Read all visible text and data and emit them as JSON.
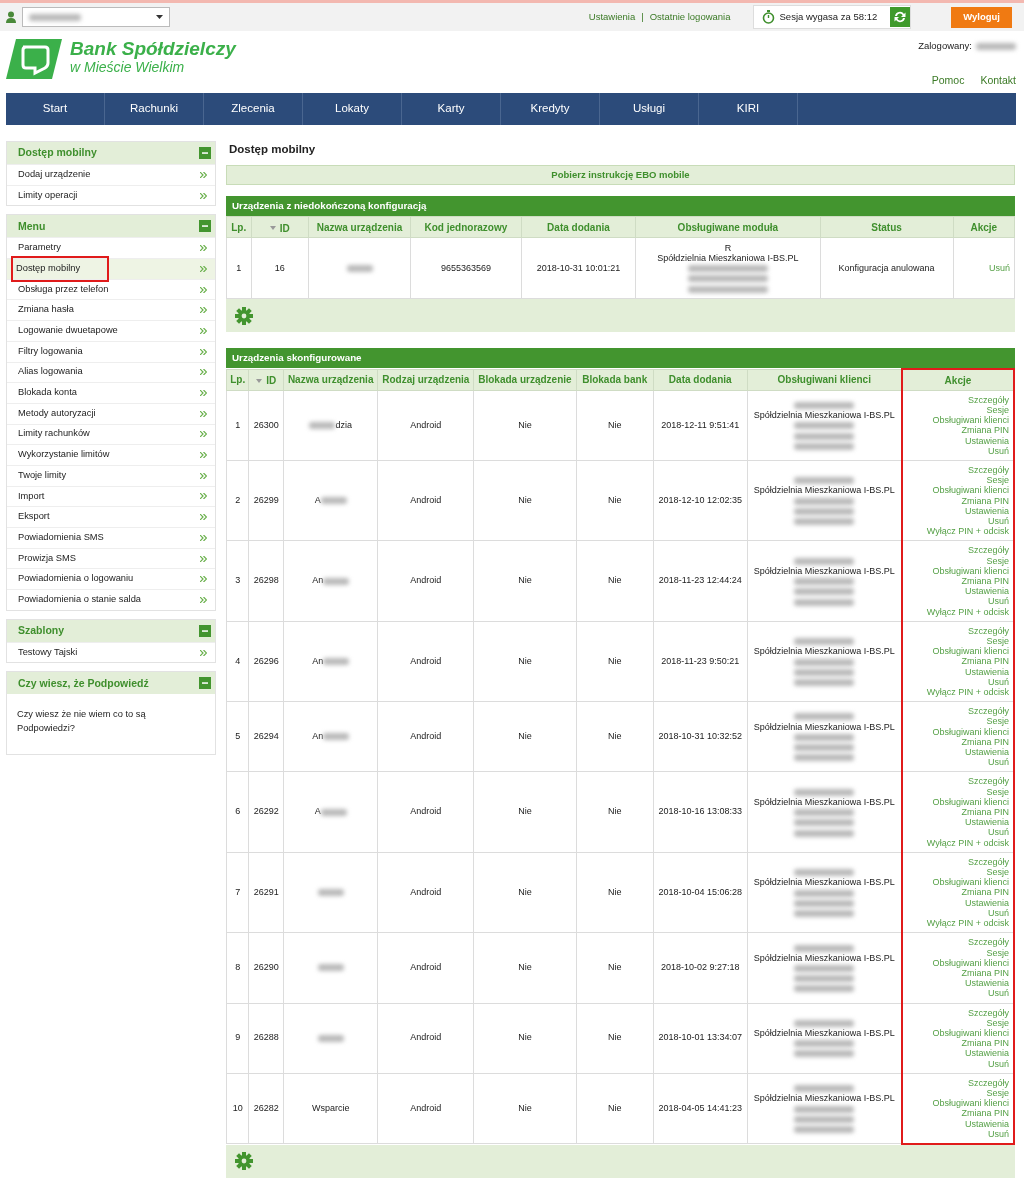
{
  "topbar": {
    "links": [
      {
        "label": "Ustawienia"
      },
      {
        "label": "Ostatnie logowania"
      }
    ],
    "separator": "|",
    "session": "Sesja wygasa za 58:12",
    "logout": "Wyloguj"
  },
  "logo": {
    "line1": "Bank Spółdzielczy",
    "line2": "w Mieście Wielkim"
  },
  "logged_in": {
    "label": "Zalogowany:"
  },
  "header_links": [
    {
      "label": "Pomoc"
    },
    {
      "label": "Kontakt"
    }
  ],
  "nav": [
    {
      "label": "Start"
    },
    {
      "label": "Rachunki"
    },
    {
      "label": "Zlecenia"
    },
    {
      "label": "Lokaty"
    },
    {
      "label": "Karty"
    },
    {
      "label": "Kredyty"
    },
    {
      "label": "Usługi"
    },
    {
      "label": "KIRI"
    }
  ],
  "sidebar": [
    {
      "title": "Dostęp mobilny",
      "kind": "links",
      "items": [
        {
          "label": "Dodaj urządzenie",
          "selected": false,
          "highlighted": false
        },
        {
          "label": "Limity operacji",
          "selected": false,
          "highlighted": false
        }
      ]
    },
    {
      "title": "Menu",
      "kind": "links",
      "items": [
        {
          "label": "Parametry",
          "selected": false,
          "highlighted": false
        },
        {
          "label": "Dostęp mobilny",
          "selected": true,
          "highlighted": true
        },
        {
          "label": "Obsługa przez telefon",
          "selected": false,
          "highlighted": false
        },
        {
          "label": "Zmiana hasła",
          "selected": false,
          "highlighted": false
        },
        {
          "label": "Logowanie dwuetapowe",
          "selected": false,
          "highlighted": false
        },
        {
          "label": "Filtry logowania",
          "selected": false,
          "highlighted": false
        },
        {
          "label": "Alias logowania",
          "selected": false,
          "highlighted": false
        },
        {
          "label": "Blokada konta",
          "selected": false,
          "highlighted": false
        },
        {
          "label": "Metody autoryzacji",
          "selected": false,
          "highlighted": false
        },
        {
          "label": "Limity rachunków",
          "selected": false,
          "highlighted": false
        },
        {
          "label": "Wykorzystanie limitów",
          "selected": false,
          "highlighted": false
        },
        {
          "label": "Twoje limity",
          "selected": false,
          "highlighted": false
        },
        {
          "label": "Import",
          "selected": false,
          "highlighted": false
        },
        {
          "label": "Eksport",
          "selected": false,
          "highlighted": false
        },
        {
          "label": "Powiadomienia SMS",
          "selected": false,
          "highlighted": false
        },
        {
          "label": "Prowizja SMS",
          "selected": false,
          "highlighted": false
        },
        {
          "label": "Powiadomienia o logowaniu",
          "selected": false,
          "highlighted": false
        },
        {
          "label": "Powiadomienia o stanie salda",
          "selected": false,
          "highlighted": false
        }
      ]
    },
    {
      "title": "Szablony",
      "kind": "links",
      "items": [
        {
          "label": "Testowy Tajski",
          "selected": false,
          "highlighted": false
        }
      ]
    },
    {
      "title": "Czy wiesz, że Podpowiedź",
      "kind": "text",
      "text": "Czy wiesz że nie wiem co to są Podpowiedzi?"
    }
  ],
  "page_title": "Dostęp mobilny",
  "instruction_link": "Pobierz instrukcję EBO mobile",
  "pending": {
    "title": "Urządzenia z niedokończoną konfiguracją",
    "columns": [
      {
        "label": "Lp.",
        "sort": false
      },
      {
        "label": "ID",
        "sort": true
      },
      {
        "label": "Nazwa urządzenia",
        "sort": false
      },
      {
        "label": "Kod jednorazowy",
        "sort": false
      },
      {
        "label": "Data dodania",
        "sort": false
      },
      {
        "label": "Obsługiwane moduła",
        "sort": false
      },
      {
        "label": "Status",
        "sort": false
      },
      {
        "label": "Akcje",
        "sort": false
      }
    ],
    "rows": [
      {
        "lp": "1",
        "id": "16",
        "name": [
          {
            "kind": "redacted"
          }
        ],
        "code": "9655363569",
        "date": "2018-10-31 10:01:21",
        "modules": [
          {
            "kind": "text",
            "text": "R"
          },
          {
            "kind": "text",
            "text": "Spółdzielnia Mieszkaniowa I-BS.PL"
          },
          {
            "kind": "redacted"
          },
          {
            "kind": "redacted"
          },
          {
            "kind": "redacted"
          }
        ],
        "status": "Konfiguracja anulowana",
        "actions": [
          "Usuń"
        ]
      }
    ]
  },
  "configured": {
    "title": "Urządzenia skonfigurowane",
    "columns": [
      {
        "label": "Lp.",
        "sort": false,
        "highlighted": false
      },
      {
        "label": "ID",
        "sort": true,
        "highlighted": false
      },
      {
        "label": "Nazwa urządzenia",
        "sort": false,
        "highlighted": false
      },
      {
        "label": "Rodzaj urządzenia",
        "sort": false,
        "highlighted": false
      },
      {
        "label": "Blokada urządzenie",
        "sort": false,
        "highlighted": false
      },
      {
        "label": "Blokada bank",
        "sort": false,
        "highlighted": false
      },
      {
        "label": "Data dodania",
        "sort": false,
        "highlighted": false
      },
      {
        "label": "Obsługiwani klienci",
        "sort": false,
        "highlighted": false
      },
      {
        "label": "Akcje",
        "sort": false,
        "highlighted": true
      }
    ],
    "rows": [
      {
        "lp": "1",
        "id": "26300",
        "name": [
          {
            "kind": "redacted"
          },
          {
            "kind": "text",
            "text": "dzia"
          }
        ],
        "type": "Android",
        "lock_device": "Nie",
        "lock_bank": "Nie",
        "date": "2018-12-11 9:51:41",
        "clients": [
          {
            "kind": "redacted"
          },
          {
            "kind": "text",
            "text": "Spółdzielnia Mieszkaniowa I-BS.PL"
          },
          {
            "kind": "redacted"
          },
          {
            "kind": "redacted"
          },
          {
            "kind": "redacted"
          }
        ],
        "actions": [
          "Szczegóły",
          "Sesje",
          "Obsługiwani klienci",
          "Zmiana PIN",
          "Ustawienia",
          "Usuń"
        ]
      },
      {
        "lp": "2",
        "id": "26299",
        "name": [
          {
            "kind": "text",
            "text": "A"
          },
          {
            "kind": "redacted"
          }
        ],
        "type": "Android",
        "lock_device": "Nie",
        "lock_bank": "Nie",
        "date": "2018-12-10 12:02:35",
        "clients": [
          {
            "kind": "redacted"
          },
          {
            "kind": "text",
            "text": "Spółdzielnia Mieszkaniowa I-BS.PL"
          },
          {
            "kind": "redacted"
          },
          {
            "kind": "redacted"
          },
          {
            "kind": "redacted"
          }
        ],
        "actions": [
          "Szczegóły",
          "Sesje",
          "Obsługiwani klienci",
          "Zmiana PIN",
          "Ustawienia",
          "Usuń",
          "Wyłącz PIN + odcisk"
        ]
      },
      {
        "lp": "3",
        "id": "26298",
        "name": [
          {
            "kind": "text",
            "text": "An"
          },
          {
            "kind": "redacted"
          }
        ],
        "type": "Android",
        "lock_device": "Nie",
        "lock_bank": "Nie",
        "date": "2018-11-23 12:44:24",
        "clients": [
          {
            "kind": "redacted"
          },
          {
            "kind": "text",
            "text": "Spółdzielnia Mieszkaniowa I-BS.PL"
          },
          {
            "kind": "redacted"
          },
          {
            "kind": "redacted"
          },
          {
            "kind": "redacted"
          }
        ],
        "actions": [
          "Szczegóły",
          "Sesje",
          "Obsługiwani klienci",
          "Zmiana PIN",
          "Ustawienia",
          "Usuń",
          "Wyłącz PIN + odcisk"
        ]
      },
      {
        "lp": "4",
        "id": "26296",
        "name": [
          {
            "kind": "text",
            "text": "An"
          },
          {
            "kind": "redacted"
          }
        ],
        "type": "Android",
        "lock_device": "Nie",
        "lock_bank": "Nie",
        "date": "2018-11-23 9:50:21",
        "clients": [
          {
            "kind": "redacted"
          },
          {
            "kind": "text",
            "text": "Spółdzielnia Mieszkaniowa I-BS.PL"
          },
          {
            "kind": "redacted"
          },
          {
            "kind": "redacted"
          },
          {
            "kind": "redacted"
          }
        ],
        "actions": [
          "Szczegóły",
          "Sesje",
          "Obsługiwani klienci",
          "Zmiana PIN",
          "Ustawienia",
          "Usuń",
          "Wyłącz PIN + odcisk"
        ]
      },
      {
        "lp": "5",
        "id": "26294",
        "name": [
          {
            "kind": "text",
            "text": "An"
          },
          {
            "kind": "redacted"
          }
        ],
        "type": "Android",
        "lock_device": "Nie",
        "lock_bank": "Nie",
        "date": "2018-10-31 10:32:52",
        "clients": [
          {
            "kind": "redacted"
          },
          {
            "kind": "text",
            "text": "Spółdzielnia Mieszkaniowa I-BS.PL"
          },
          {
            "kind": "redacted"
          },
          {
            "kind": "redacted"
          },
          {
            "kind": "redacted"
          }
        ],
        "actions": [
          "Szczegóły",
          "Sesje",
          "Obsługiwani klienci",
          "Zmiana PIN",
          "Ustawienia",
          "Usuń"
        ]
      },
      {
        "lp": "6",
        "id": "26292",
        "name": [
          {
            "kind": "text",
            "text": "A"
          },
          {
            "kind": "redacted"
          }
        ],
        "type": "Android",
        "lock_device": "Nie",
        "lock_bank": "Nie",
        "date": "2018-10-16 13:08:33",
        "clients": [
          {
            "kind": "redacted"
          },
          {
            "kind": "text",
            "text": "Spółdzielnia Mieszkaniowa I-BS.PL"
          },
          {
            "kind": "redacted"
          },
          {
            "kind": "redacted"
          },
          {
            "kind": "redacted"
          }
        ],
        "actions": [
          "Szczegóły",
          "Sesje",
          "Obsługiwani klienci",
          "Zmiana PIN",
          "Ustawienia",
          "Usuń",
          "Wyłącz PIN + odcisk"
        ]
      },
      {
        "lp": "7",
        "id": "26291",
        "name": [
          {
            "kind": "redacted"
          }
        ],
        "type": "Android",
        "lock_device": "Nie",
        "lock_bank": "Nie",
        "date": "2018-10-04 15:06:28",
        "clients": [
          {
            "kind": "redacted"
          },
          {
            "kind": "text",
            "text": "Spółdzielnia Mieszkaniowa I-BS.PL"
          },
          {
            "kind": "redacted"
          },
          {
            "kind": "redacted"
          },
          {
            "kind": "redacted"
          }
        ],
        "actions": [
          "Szczegóły",
          "Sesje",
          "Obsługiwani klienci",
          "Zmiana PIN",
          "Ustawienia",
          "Usuń",
          "Wyłącz PIN + odcisk"
        ]
      },
      {
        "lp": "8",
        "id": "26290",
        "name": [
          {
            "kind": "redacted"
          }
        ],
        "type": "Android",
        "lock_device": "Nie",
        "lock_bank": "Nie",
        "date": "2018-10-02 9:27:18",
        "clients": [
          {
            "kind": "redacted"
          },
          {
            "kind": "text",
            "text": "Spółdzielnia Mieszkaniowa I-BS.PL"
          },
          {
            "kind": "redacted"
          },
          {
            "kind": "redacted"
          },
          {
            "kind": "redacted"
          }
        ],
        "actions": [
          "Szczegóły",
          "Sesje",
          "Obsługiwani klienci",
          "Zmiana PIN",
          "Ustawienia",
          "Usuń"
        ]
      },
      {
        "lp": "9",
        "id": "26288",
        "name": [
          {
            "kind": "redacted"
          }
        ],
        "type": "Android",
        "lock_device": "Nie",
        "lock_bank": "Nie",
        "date": "2018-10-01 13:34:07",
        "clients": [
          {
            "kind": "redacted"
          },
          {
            "kind": "text",
            "text": "Spółdzielnia Mieszkaniowa I-BS.PL"
          },
          {
            "kind": "redacted"
          },
          {
            "kind": "redacted"
          }
        ],
        "actions": [
          "Szczegóły",
          "Sesje",
          "Obsługiwani klienci",
          "Zmiana PIN",
          "Ustawienia",
          "Usuń"
        ]
      },
      {
        "lp": "10",
        "id": "26282",
        "name": [
          {
            "kind": "text",
            "text": "Wsparcie"
          }
        ],
        "type": "Android",
        "lock_device": "Nie",
        "lock_bank": "Nie",
        "date": "2018-04-05 14:41:23",
        "clients": [
          {
            "kind": "redacted"
          },
          {
            "kind": "text",
            "text": "Spółdzielnia Mieszkaniowa I-BS.PL"
          },
          {
            "kind": "redacted"
          },
          {
            "kind": "redacted"
          },
          {
            "kind": "redacted"
          }
        ],
        "actions": [
          "Szczegóły",
          "Sesje",
          "Obsługiwani klienci",
          "Zmiana PIN",
          "Ustawienia",
          "Usuń"
        ]
      }
    ]
  }
}
